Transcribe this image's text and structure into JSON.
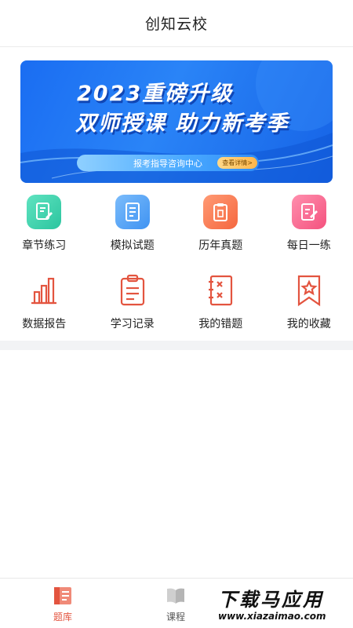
{
  "header": {
    "title": "创知云校"
  },
  "banner": {
    "line1": "2023重磅升级",
    "line2": "双师授课  助力新考季",
    "pill_text": "报考指导咨询中心",
    "pill_button": "查看详情>"
  },
  "grid": {
    "row1": [
      {
        "label": "章节练习",
        "icon": "pencil-note-icon",
        "color": "#3fd2b0"
      },
      {
        "label": "模拟试题",
        "icon": "document-icon",
        "color": "#58a8f6"
      },
      {
        "label": "历年真题",
        "icon": "clipboard-icon",
        "color": "#fb7d5a"
      },
      {
        "label": "每日一练",
        "icon": "edit-note-icon",
        "color": "#fb6e93"
      }
    ],
    "row2": [
      {
        "label": "数据报告",
        "icon": "bar-chart-icon"
      },
      {
        "label": "学习记录",
        "icon": "clipboard-list-icon"
      },
      {
        "label": "我的错题",
        "icon": "wrong-notebook-icon"
      },
      {
        "label": "我的收藏",
        "icon": "star-bookmark-icon"
      }
    ],
    "outline_color": "#e3543f"
  },
  "tabbar": {
    "items": [
      {
        "label": "题库",
        "icon": "question-bank-icon",
        "active": true
      },
      {
        "label": "课程",
        "icon": "book-icon",
        "active": false
      }
    ],
    "active_color": "#e3543f",
    "inactive_color": "#555555"
  },
  "watermark": {
    "big": "下载马应用",
    "small": "www.xiazaimao.com"
  }
}
